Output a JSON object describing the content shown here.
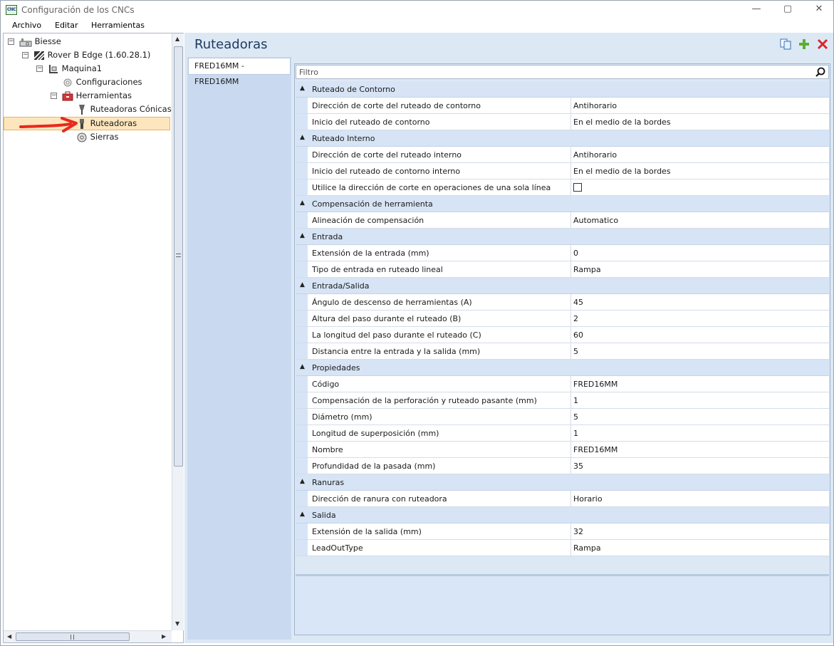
{
  "window": {
    "icon_text": "CNC",
    "title": "Configuración de los CNCs",
    "minimize": "—",
    "maximize": "▢",
    "close": "✕"
  },
  "menu": [
    "Archivo",
    "Editar",
    "Herramientas"
  ],
  "tree": {
    "biesse": "Biesse",
    "machine": "Rover B Edge (1.60.28.1)",
    "maquina": "Maquina1",
    "configuraciones": "Configuraciones",
    "herramientas": "Herramientas",
    "ruteadoras_conicas": "Ruteadoras Cónicas",
    "ruteadoras": "Ruteadoras",
    "sierras": "Sierras"
  },
  "colors": {
    "annotation_arrow": "#e8291f",
    "accent": "#1e3a5f"
  },
  "panel": {
    "title": "Ruteadoras",
    "list_items": [
      "FRED16MM - FRED16MM"
    ],
    "filter_placeholder": "Filtro"
  },
  "categories": [
    {
      "label": "Ruteado de Contorno",
      "props": [
        {
          "key": "Dirección de corte del ruteado de contorno",
          "value": "Antihorario"
        },
        {
          "key": "Inicio del ruteado de contorno",
          "value": "En el medio de la bordes"
        }
      ]
    },
    {
      "label": "Ruteado Interno",
      "props": [
        {
          "key": "Dirección de corte del ruteado interno",
          "value": "Antihorario"
        },
        {
          "key": "Inicio del ruteado de contorno interno",
          "value": "En el medio de la bordes"
        },
        {
          "key": "Utilice la dirección de corte en operaciones de una sola línea",
          "value": "",
          "checkbox": true
        }
      ]
    },
    {
      "label": "Compensación de herramienta",
      "props": [
        {
          "key": "Alineación de compensación",
          "value": "Automatico"
        }
      ]
    },
    {
      "label": "Entrada",
      "props": [
        {
          "key": "Extensión de la entrada (mm)",
          "value": "0"
        },
        {
          "key": "Tipo de entrada en ruteado lineal",
          "value": "Rampa"
        }
      ]
    },
    {
      "label": "Entrada/Salida",
      "props": [
        {
          "key": "Ángulo de descenso de herramientas (A)",
          "value": "45"
        },
        {
          "key": "Altura del paso durante el ruteado (B)",
          "value": "2"
        },
        {
          "key": "La longitud del paso durante el ruteado (C)",
          "value": "60"
        },
        {
          "key": "Distancia entre la entrada y la salida (mm)",
          "value": "5"
        }
      ]
    },
    {
      "label": "Propiedades",
      "props": [
        {
          "key": "Código",
          "value": "FRED16MM"
        },
        {
          "key": "Compensación de la perforación y ruteado pasante (mm)",
          "value": "1"
        },
        {
          "key": "Diámetro (mm)",
          "value": "5"
        },
        {
          "key": "Longitud de superposición (mm)",
          "value": "1"
        },
        {
          "key": "Nombre",
          "value": "FRED16MM"
        },
        {
          "key": "Profundidad de la pasada (mm)",
          "value": "35"
        }
      ]
    },
    {
      "label": "Ranuras",
      "props": [
        {
          "key": " Dirección de ranura con ruteadora",
          "value": "Horario"
        }
      ]
    },
    {
      "label": "Salida",
      "props": [
        {
          "key": "Extensión de la salida (mm)",
          "value": "32"
        },
        {
          "key": "LeadOutType",
          "value": "Rampa"
        }
      ]
    }
  ]
}
